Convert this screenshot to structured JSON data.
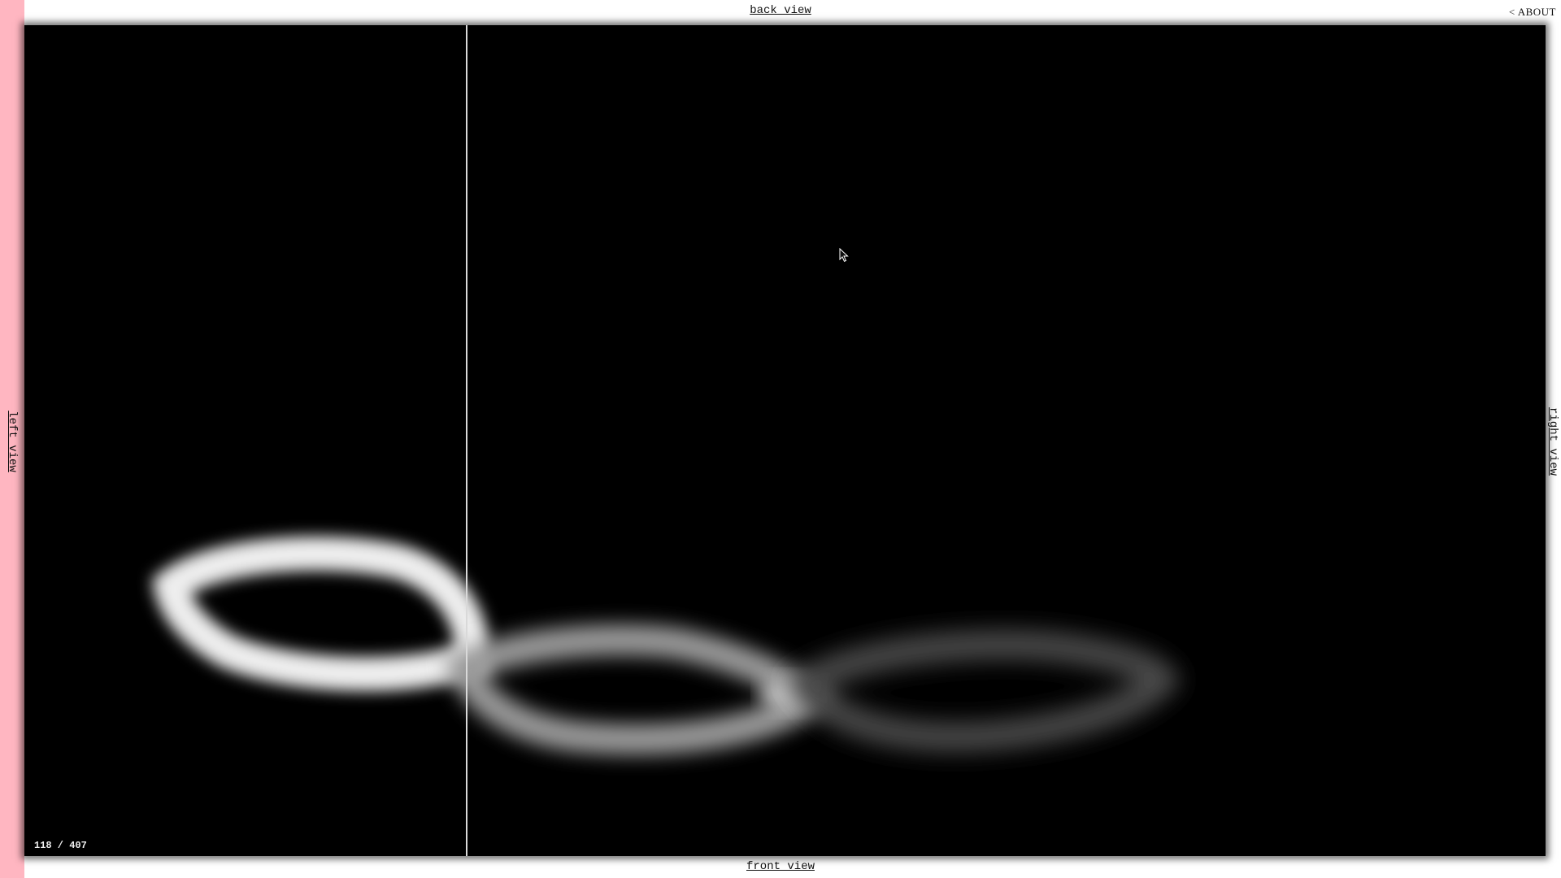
{
  "nav": {
    "back_view": "back view",
    "front_view": "front view",
    "left_view": "left view",
    "right_view": "right view",
    "about": "< ABOUT"
  },
  "viewer": {
    "frame_counter": "118 / 407",
    "slice_position": 0.29,
    "background": "#000000"
  },
  "colors": {
    "accent_strip": "#ffb6c1",
    "page_background": "#ffffff",
    "slice_line": "#d9d9d9"
  },
  "icons": {
    "cursor": "pointer-cursor-icon"
  }
}
